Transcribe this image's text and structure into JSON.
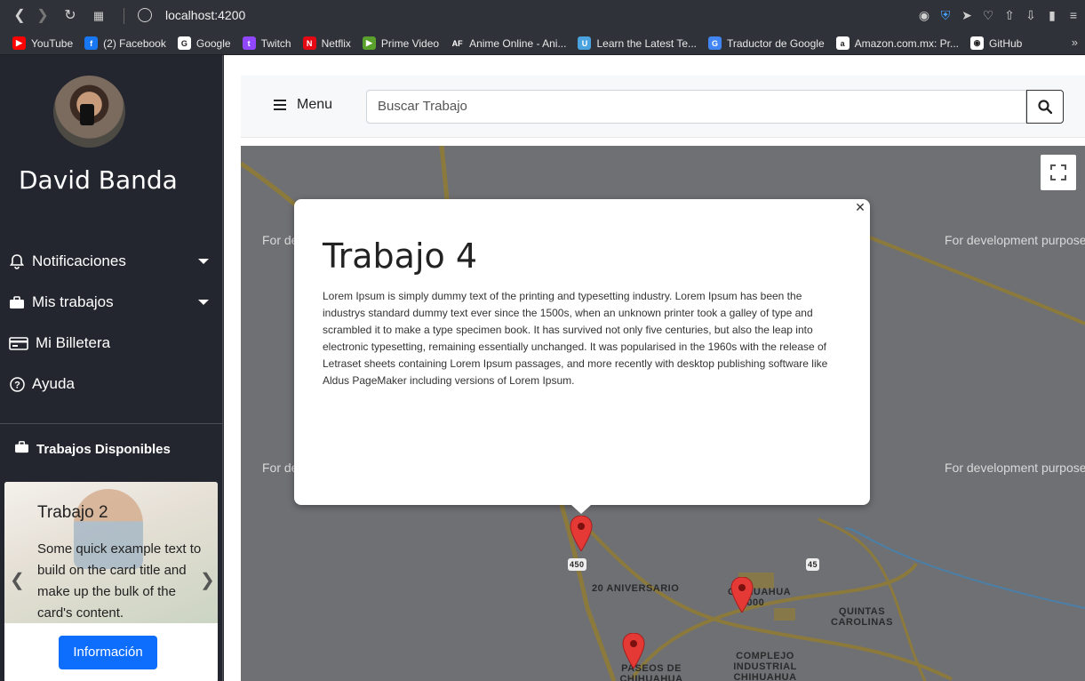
{
  "browser": {
    "url": "localhost:4200",
    "bookmarks": [
      {
        "label": "YouTube",
        "color": "#ff0000",
        "glyph": "▶"
      },
      {
        "label": "(2) Facebook",
        "color": "#1877f2",
        "glyph": "f"
      },
      {
        "label": "Google",
        "color": "#ffffff",
        "glyph": "G"
      },
      {
        "label": "Twitch",
        "color": "#9146ff",
        "glyph": "t"
      },
      {
        "label": "Netflix",
        "color": "#e50914",
        "glyph": "N"
      },
      {
        "label": "Prime Video",
        "color": "#5aa02c",
        "glyph": "▶"
      },
      {
        "label": "Anime Online - Ani...",
        "color": "#2f3238",
        "glyph": "AF"
      },
      {
        "label": "Learn the Latest Te...",
        "color": "#4aa3df",
        "glyph": "U"
      },
      {
        "label": "Traductor de Google",
        "color": "#4285f4",
        "glyph": "G"
      },
      {
        "label": "Amazon.com.mx: Pr...",
        "color": "#ffffff",
        "glyph": "a"
      },
      {
        "label": "GitHub",
        "color": "#ffffff",
        "glyph": "◉"
      }
    ]
  },
  "sidebar": {
    "user_name": "David Banda",
    "items": [
      {
        "label": "Notificaciones",
        "icon": "bell-icon",
        "has_dropdown": true
      },
      {
        "label": "Mis trabajos",
        "icon": "briefcase-icon",
        "has_dropdown": true
      },
      {
        "label": "Mi Billetera",
        "icon": "wallet-icon",
        "has_dropdown": false
      },
      {
        "label": "Ayuda",
        "icon": "question-icon",
        "has_dropdown": false
      }
    ],
    "section_title": "Trabajos Disponibles",
    "card": {
      "title": "Trabajo 2",
      "text": "Some quick example text to build on the card title and make up the bulk of the card's content.",
      "button_label": "Información"
    }
  },
  "header": {
    "menu_label": "Menu",
    "search_placeholder": "Buscar Trabajo"
  },
  "map": {
    "watermark": "For development purposes only",
    "labels": [
      "20 ANIVERSARIO",
      "CHIHUAHUA 2000",
      "QUINTAS CAROLINAS",
      "COMPLEJO INDUSTRIAL CHIHUAHUA",
      "PASEOS DE CHIHUAHUA",
      "450",
      "45"
    ],
    "info_window": {
      "title": "Trabajo 4",
      "text": "Lorem Ipsum is simply dummy text of the printing and typesetting industry. Lorem Ipsum has been the industrys standard dummy text ever since the 1500s, when an unknown printer took a galley of type and scrambled it to make a type specimen book. It has survived not only five centuries, but also the leap into electronic typesetting, remaining essentially unchanged. It was popularised in the 1960s with the release of Letraset sheets containing Lorem Ipsum passages, and more recently with desktop publishing software like Aldus PageMaker including versions of Lorem Ipsum."
    }
  },
  "colors": {
    "sidebar_bg": "#23262e",
    "primary": "#0d6efd",
    "marker": "#e53935"
  }
}
